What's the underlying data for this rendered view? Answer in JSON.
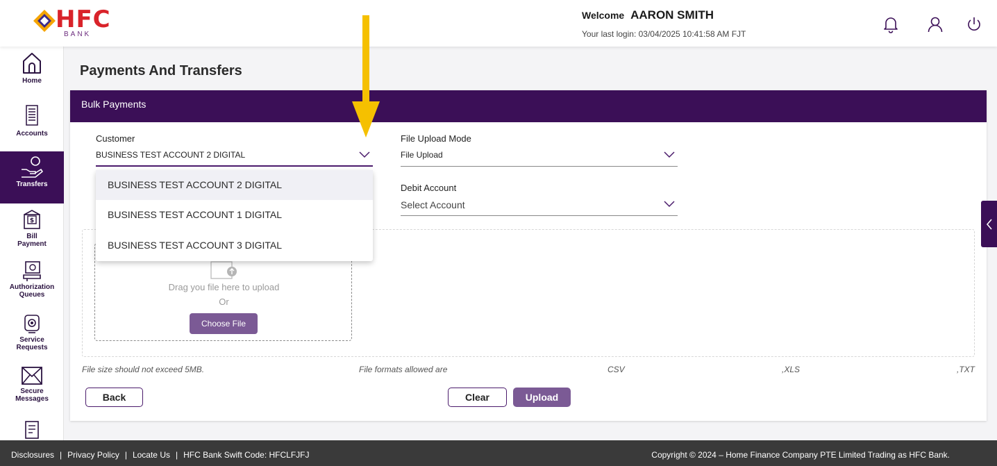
{
  "header": {
    "logo_text": "HFC",
    "logo_sub": "BANK",
    "welcome_label": "Welcome",
    "user_name": "AARON SMITH",
    "last_login": "Your last login: 03/04/2025 10:41:58 AM FJT"
  },
  "sidebar": {
    "items": [
      {
        "label": "Home"
      },
      {
        "label": "Accounts"
      },
      {
        "label": "Transfers"
      },
      {
        "label_line1": "Bill",
        "label_line2": "Payment"
      },
      {
        "label_line1": "Authorization",
        "label_line2": "Queues"
      },
      {
        "label_line1": "Service",
        "label_line2": "Requests"
      },
      {
        "label_line1": "Secure",
        "label_line2": "Messages"
      }
    ]
  },
  "page": {
    "title": "Payments And Transfers",
    "section_title": "Bulk Payments"
  },
  "form": {
    "customer_label": "Customer",
    "customer_value": "BUSINESS TEST ACCOUNT 2 DIGITAL",
    "upload_mode_label": "File Upload Mode",
    "upload_mode_value": "File Upload",
    "debit_label": "Debit Account",
    "debit_placeholder": "Select Account"
  },
  "dropdown": {
    "options": [
      "BUSINESS TEST ACCOUNT 2 DIGITAL",
      "BUSINESS TEST ACCOUNT 1 DIGITAL",
      "BUSINESS TEST ACCOUNT 3 DIGITAL"
    ],
    "selected_index": 0
  },
  "upload": {
    "drag_text": "Drag you file here to upload",
    "or_text": "Or",
    "choose_label": "Choose File"
  },
  "notes": {
    "size": "File size should not exceed 5MB.",
    "formats_label": "File formats allowed are",
    "fmt_csv": "CSV",
    "fmt_xls": ",XLS",
    "fmt_txt": ",TXT"
  },
  "buttons": {
    "back": "Back",
    "clear": "Clear",
    "upload": "Upload"
  },
  "footer": {
    "disclosures": "Disclosures",
    "privacy": "Privacy Policy",
    "locate": "Locate Us",
    "swift": "HFC Bank Swift Code: HFCLFJFJ",
    "copyright": "Copyright © 2024 – Home Finance Company PTE Limited Trading as HFC Bank.",
    "separator": "|"
  },
  "colors": {
    "brand_purple": "#3b0f57",
    "button_purple": "#7b5a95",
    "logo_red": "#d9232a",
    "annotation_yellow": "#f5c000"
  },
  "icons": [
    "bell-icon",
    "user-icon",
    "power-icon",
    "home-icon",
    "accounts-icon",
    "transfers-icon",
    "bill-payment-icon",
    "authorization-icon",
    "service-requests-icon",
    "secure-messages-icon",
    "chevron-down-icon",
    "chevron-left-icon",
    "upload-file-icon"
  ]
}
